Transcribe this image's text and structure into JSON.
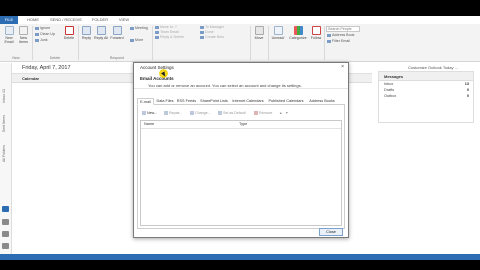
{
  "tabs": {
    "file": "FILE",
    "home": "HOME",
    "send_receive": "SEND / RECEIVE",
    "folder": "FOLDER",
    "view": "VIEW"
  },
  "ribbon": {
    "new_email": "New",
    "new_email_2": "Email",
    "new_items": "New",
    "new_items_2": "Items",
    "new_group": "New",
    "ignore": "Ignore",
    "clean_up": "Clean Up",
    "junk": "Junk",
    "delete": "Delete",
    "delete_group": "Delete",
    "reply": "Reply",
    "reply_all": "Reply All",
    "forward": "Forward",
    "more": "More",
    "meeting": "Meeting",
    "respond_group": "Respond",
    "move_to": "Move to: ?",
    "team_email": "Team Email",
    "reply_delete": "Reply & Delete",
    "to_manager": "To Manager",
    "done": "Done",
    "create_new": "Create New",
    "move": "Move",
    "unread": "Unread/",
    "categorize": "Categorize",
    "follow": "Follow",
    "search_people": "Search People",
    "address_book": "Address Book",
    "filter_email": "Filter Email"
  },
  "nav": {
    "inbox": "Inbox 13",
    "sent_items": "Sent Items",
    "all_folders": "All Folders"
  },
  "calendar": {
    "date": "Friday, April 7, 2017",
    "customize": "Customize Outlook Today ...",
    "label": "Calendar"
  },
  "messages": {
    "title": "Messages",
    "rows": [
      {
        "name": "Inbox",
        "count": "13"
      },
      {
        "name": "Drafts",
        "count": "0"
      },
      {
        "name": "Outbox",
        "count": "0"
      }
    ]
  },
  "dialog": {
    "title": "Account Settings",
    "close_x": "×",
    "heading": "Email Accounts",
    "description": "You can add or remove an account. You can select an account and change its settings.",
    "tabs": [
      "E-mail",
      "Data Files",
      "RSS Feeds",
      "SharePoint Lists",
      "Internet Calendars",
      "Published Calendars",
      "Address Books"
    ],
    "toolbar": {
      "new": "New...",
      "repair": "Repair...",
      "change": "Change...",
      "set_default": "Set as Default",
      "remove": "Remove"
    },
    "columns": {
      "name": "Name",
      "type": "Type"
    },
    "close_button": "Close"
  },
  "colors": {
    "accent": "#2b6cb2",
    "highlight": "#f2d400"
  }
}
